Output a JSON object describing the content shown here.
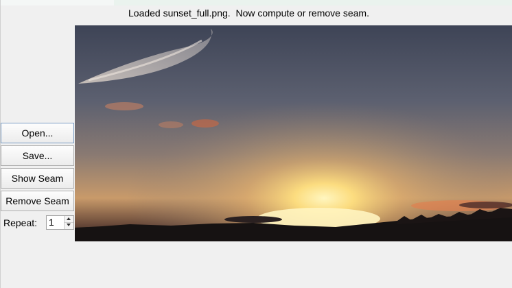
{
  "status": {
    "message": "Loaded sunset_full.png.  Now compute or remove seam."
  },
  "image": {
    "description_name": "sunset-image"
  },
  "controls": {
    "open_label": "Open...",
    "save_label": "Save...",
    "show_seam_label": "Show Seam",
    "remove_seam_label": "Remove Seam",
    "repeat_label": "Repeat:",
    "repeat_value": "1"
  },
  "colors": {
    "window_bg": "#f0f0f0",
    "sky_top": "#5a6272",
    "sun": "#fff2b0",
    "horizon": "#e8a050",
    "ground": "#1a1616"
  },
  "icons": {
    "spin_up": "up-arrow-icon",
    "spin_down": "down-arrow-icon"
  }
}
